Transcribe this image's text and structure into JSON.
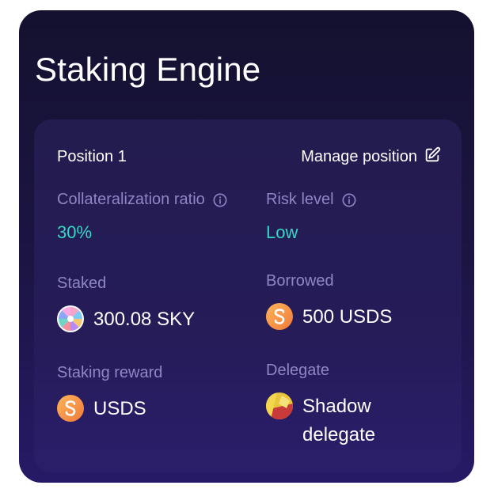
{
  "card": {
    "title": "Staking Engine"
  },
  "position": {
    "label": "Position 1",
    "manage_label": "Manage position"
  },
  "fields": {
    "collateralization": {
      "label": "Collateralization ratio",
      "value": "30%"
    },
    "risk": {
      "label": "Risk level",
      "value": "Low"
    },
    "staked": {
      "label": "Staked",
      "value": "300.08 SKY",
      "token_icon": "sky-token-icon"
    },
    "borrowed": {
      "label": "Borrowed",
      "value": "500 USDS",
      "token_icon": "usds-token-icon"
    },
    "staking_reward": {
      "label": "Staking reward",
      "value": "USDS",
      "token_icon": "usds-token-icon"
    },
    "delegate": {
      "label": "Delegate",
      "value_line1": "Shadow",
      "value_line2": "delegate",
      "icon": "shadow-delegate-avatar"
    }
  },
  "colors": {
    "card_bg_top": "#14112f",
    "card_bg_bottom": "#261a66",
    "label": "#8f86c4",
    "accent": "#34d8c5",
    "usds_orange": "#f7a14a"
  }
}
